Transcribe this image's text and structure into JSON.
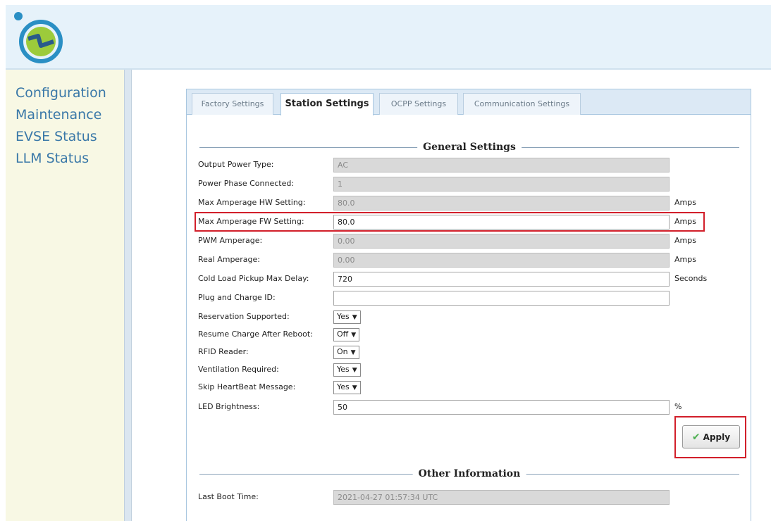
{
  "nav": [
    "Configuration",
    "Maintenance",
    "EVSE Status",
    "LLM Status"
  ],
  "tabs": [
    "Factory Settings",
    "Station Settings",
    "OCPP Settings",
    "Communication Settings"
  ],
  "general_title": "General Settings",
  "fields": {
    "output_power_type": {
      "label": "Output Power Type:",
      "value": "AC"
    },
    "power_phase": {
      "label": "Power Phase Connected:",
      "value": "1"
    },
    "max_hw": {
      "label": "Max Amperage HW Setting:",
      "value": "80.0",
      "unit": "Amps"
    },
    "max_fw": {
      "label": "Max Amperage FW Setting:",
      "value": "80.0",
      "unit": "Amps"
    },
    "pwm": {
      "label": "PWM Amperage:",
      "value": "0.00",
      "unit": "Amps"
    },
    "real": {
      "label": "Real Amperage:",
      "value": "0.00",
      "unit": "Amps"
    },
    "cold_load": {
      "label": "Cold Load Pickup Max Delay:",
      "value": "720",
      "unit": "Seconds"
    },
    "plug_charge": {
      "label": "Plug and Charge ID:",
      "value": ""
    },
    "reservation": {
      "label": "Reservation Supported:",
      "value": "Yes"
    },
    "resume": {
      "label": "Resume Charge After Reboot:",
      "value": "Off"
    },
    "rfid": {
      "label": "RFID Reader:",
      "value": "On"
    },
    "ventilation": {
      "label": "Ventilation Required:",
      "value": "Yes"
    },
    "heartbeat": {
      "label": "Skip HeartBeat Message:",
      "value": "Yes"
    },
    "led": {
      "label": "LED Brightness:",
      "value": "50",
      "unit": "%"
    }
  },
  "apply_label": "Apply",
  "other_title": "Other Information",
  "last_boot": {
    "label": "Last Boot Time:",
    "value": "2021-04-27 01:57:34 UTC"
  },
  "colors": {
    "accent_red": "#d21f2a",
    "nav_blue": "#3a78a8",
    "header_bg": "#e6f2fa"
  }
}
